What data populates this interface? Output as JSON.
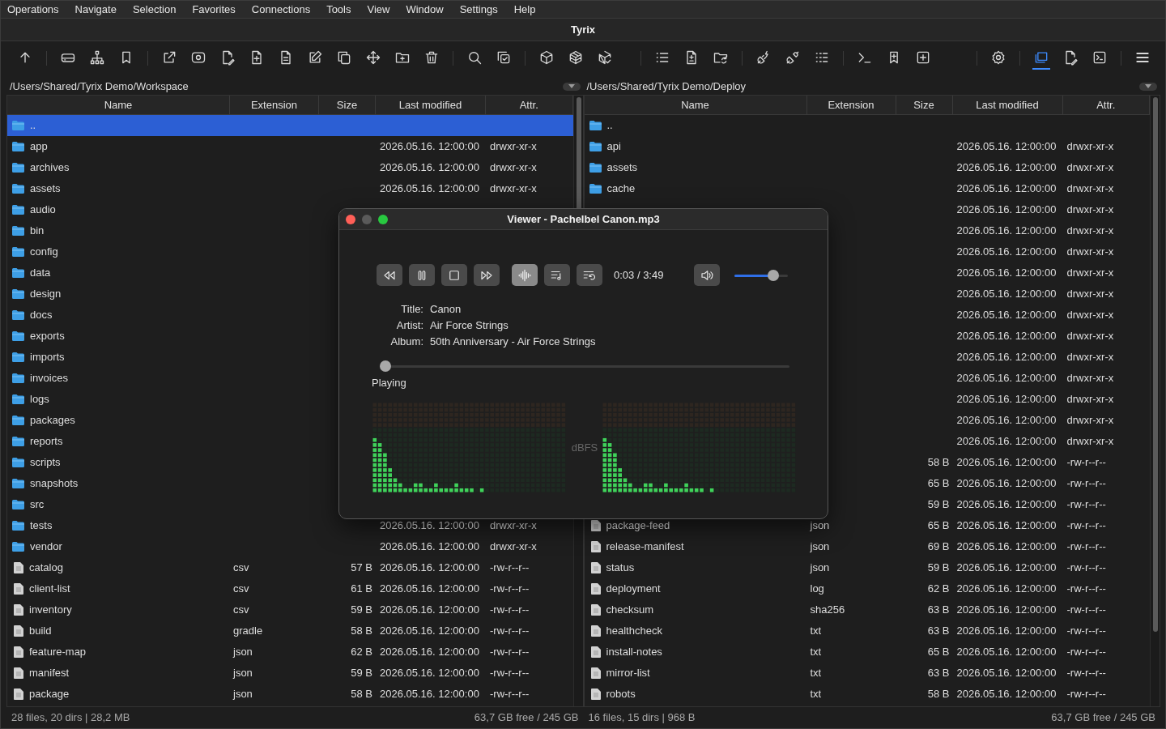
{
  "menu": [
    "Operations",
    "Navigate",
    "Selection",
    "Favorites",
    "Connections",
    "Tools",
    "View",
    "Window",
    "Settings",
    "Help"
  ],
  "window": {
    "title": "Tyrix"
  },
  "toolbar": {
    "groups": [
      [
        {
          "kind": "up",
          "selected": false
        }
      ],
      [
        {
          "kind": "drive",
          "selected": false
        },
        {
          "kind": "tree",
          "selected": false
        },
        {
          "kind": "bookmark",
          "selected": false
        }
      ],
      [
        {
          "kind": "external",
          "selected": false
        },
        {
          "kind": "view",
          "selected": false
        },
        {
          "kind": "edit-file",
          "selected": false
        },
        {
          "kind": "new-file",
          "selected": false
        },
        {
          "kind": "compare-file",
          "selected": false
        },
        {
          "kind": "edit",
          "selected": false
        },
        {
          "kind": "copy",
          "selected": false
        },
        {
          "kind": "move",
          "selected": false
        },
        {
          "kind": "new-folder",
          "selected": false
        },
        {
          "kind": "delete",
          "selected": false
        }
      ],
      [
        {
          "kind": "search",
          "selected": false
        },
        {
          "kind": "select",
          "selected": false
        }
      ],
      [
        {
          "kind": "package",
          "selected": false
        },
        {
          "kind": "packages",
          "selected": false
        },
        {
          "kind": "package-check",
          "selected": false
        }
      ],
      [
        {
          "kind": "list",
          "selected": false
        },
        {
          "kind": "file-diff",
          "selected": false
        },
        {
          "kind": "folder-sync",
          "selected": false
        }
      ],
      [
        {
          "kind": "connect",
          "selected": false
        },
        {
          "kind": "disconnect",
          "selected": false
        },
        {
          "kind": "list-dots",
          "selected": false
        }
      ],
      [
        {
          "kind": "terminal",
          "selected": false
        },
        {
          "kind": "bookmark-add",
          "selected": false
        },
        {
          "kind": "add",
          "selected": false
        }
      ],
      [
        {
          "kind": "settings",
          "selected": false
        }
      ],
      [
        {
          "kind": "panels",
          "selected": true
        },
        {
          "kind": "file-edit",
          "selected": false
        },
        {
          "kind": "console",
          "selected": false
        }
      ],
      [
        {
          "kind": "menu",
          "selected": false
        }
      ]
    ]
  },
  "panels": [
    {
      "path": "/Users/Shared/Tyrix Demo/Workspace",
      "columns": [
        "Name",
        "Extension",
        "Size",
        "Last modified",
        "Attr."
      ],
      "rows": [
        {
          "kind": "up",
          "name": "..",
          "selected": true
        },
        {
          "kind": "folder",
          "name": "app",
          "date": "2026.05.16. 12:00:00",
          "attr": "drwxr-xr-x",
          "selected": false
        },
        {
          "kind": "folder",
          "name": "archives",
          "date": "2026.05.16. 12:00:00",
          "attr": "drwxr-xr-x",
          "selected": false
        },
        {
          "kind": "folder",
          "name": "assets",
          "date": "2026.05.16. 12:00:00",
          "attr": "drwxr-xr-x",
          "selected": false
        },
        {
          "kind": "folder",
          "name": "audio",
          "selected": false
        },
        {
          "kind": "folder",
          "name": "bin",
          "selected": false
        },
        {
          "kind": "folder",
          "name": "config",
          "selected": false
        },
        {
          "kind": "folder",
          "name": "data",
          "selected": false
        },
        {
          "kind": "folder",
          "name": "design",
          "selected": false
        },
        {
          "kind": "folder",
          "name": "docs",
          "selected": false
        },
        {
          "kind": "folder",
          "name": "exports",
          "selected": false
        },
        {
          "kind": "folder",
          "name": "imports",
          "selected": false
        },
        {
          "kind": "folder",
          "name": "invoices",
          "selected": false
        },
        {
          "kind": "folder",
          "name": "logs",
          "selected": false
        },
        {
          "kind": "folder",
          "name": "packages",
          "selected": false
        },
        {
          "kind": "folder",
          "name": "reports",
          "selected": false
        },
        {
          "kind": "folder",
          "name": "scripts",
          "selected": false
        },
        {
          "kind": "folder",
          "name": "snapshots",
          "selected": false
        },
        {
          "kind": "folder",
          "name": "src",
          "selected": false
        },
        {
          "kind": "folder",
          "name": "tests",
          "date": "2026.05.16. 12:00:00",
          "attr": "drwxr-xr-x",
          "selected": false
        },
        {
          "kind": "folder",
          "name": "vendor",
          "date": "2026.05.16. 12:00:00",
          "attr": "drwxr-xr-x",
          "selected": false
        },
        {
          "kind": "file",
          "name": "catalog",
          "ext": "csv",
          "size": "57 B",
          "date": "2026.05.16. 12:00:00",
          "attr": "-rw-r--r--",
          "selected": false
        },
        {
          "kind": "file",
          "name": "client-list",
          "ext": "csv",
          "size": "61 B",
          "date": "2026.05.16. 12:00:00",
          "attr": "-rw-r--r--",
          "selected": false
        },
        {
          "kind": "file",
          "name": "inventory",
          "ext": "csv",
          "size": "59 B",
          "date": "2026.05.16. 12:00:00",
          "attr": "-rw-r--r--",
          "selected": false
        },
        {
          "kind": "file",
          "name": "build",
          "ext": "gradle",
          "size": "58 B",
          "date": "2026.05.16. 12:00:00",
          "attr": "-rw-r--r--",
          "selected": false
        },
        {
          "kind": "file",
          "name": "feature-map",
          "ext": "json",
          "size": "62 B",
          "date": "2026.05.16. 12:00:00",
          "attr": "-rw-r--r--",
          "selected": false
        },
        {
          "kind": "file",
          "name": "manifest",
          "ext": "json",
          "size": "59 B",
          "date": "2026.05.16. 12:00:00",
          "attr": "-rw-r--r--",
          "selected": false
        },
        {
          "kind": "file",
          "name": "package",
          "ext": "json",
          "size": "58 B",
          "date": "2026.05.16. 12:00:00",
          "attr": "-rw-r--r--",
          "selected": false
        }
      ],
      "status": {
        "summary": "28 files, 20 dirs | 28,2 MB",
        "free": "63,7 GB free / 245 GB"
      }
    },
    {
      "path": "/Users/Shared/Tyrix Demo/Deploy",
      "columns": [
        "Name",
        "Extension",
        "Size",
        "Last modified",
        "Attr."
      ],
      "rows": [
        {
          "kind": "up",
          "name": "..",
          "selected": false
        },
        {
          "kind": "folder",
          "name": "api",
          "date": "2026.05.16. 12:00:00",
          "attr": "drwxr-xr-x",
          "selected": false
        },
        {
          "kind": "folder",
          "name": "assets",
          "date": "2026.05.16. 12:00:00",
          "attr": "drwxr-xr-x",
          "selected": false
        },
        {
          "kind": "folder",
          "name": "cache",
          "date": "2026.05.16. 12:00:00",
          "attr": "drwxr-xr-x",
          "selected": false
        },
        {
          "date": "2026.05.16. 12:00:00",
          "attr": "drwxr-xr-x",
          "selected": false
        },
        {
          "date": "2026.05.16. 12:00:00",
          "attr": "drwxr-xr-x",
          "selected": false
        },
        {
          "date": "2026.05.16. 12:00:00",
          "attr": "drwxr-xr-x",
          "selected": false
        },
        {
          "date": "2026.05.16. 12:00:00",
          "attr": "drwxr-xr-x",
          "selected": false
        },
        {
          "date": "2026.05.16. 12:00:00",
          "attr": "drwxr-xr-x",
          "selected": false
        },
        {
          "date": "2026.05.16. 12:00:00",
          "attr": "drwxr-xr-x",
          "selected": false
        },
        {
          "date": "2026.05.16. 12:00:00",
          "attr": "drwxr-xr-x",
          "selected": false
        },
        {
          "date": "2026.05.16. 12:00:00",
          "attr": "drwxr-xr-x",
          "selected": false
        },
        {
          "date": "2026.05.16. 12:00:00",
          "attr": "drwxr-xr-x",
          "selected": false
        },
        {
          "date": "2026.05.16. 12:00:00",
          "attr": "drwxr-xr-x",
          "selected": false
        },
        {
          "date": "2026.05.16. 12:00:00",
          "attr": "drwxr-xr-x",
          "selected": false
        },
        {
          "date": "2026.05.16. 12:00:00",
          "attr": "drwxr-xr-x",
          "selected": false
        },
        {
          "size": "58 B",
          "date": "2026.05.16. 12:00:00",
          "attr": "-rw-r--r--",
          "selected": false
        },
        {
          "size": "65 B",
          "date": "2026.05.16. 12:00:00",
          "attr": "-rw-r--r--",
          "selected": false
        },
        {
          "size": "59 B",
          "date": "2026.05.16. 12:00:00",
          "attr": "-rw-r--r--",
          "selected": false
        },
        {
          "kind": "file",
          "name": "package-feed",
          "ext": "json",
          "size": "65 B",
          "date": "2026.05.16. 12:00:00",
          "attr": "-rw-r--r--",
          "selected": false
        },
        {
          "kind": "file",
          "name": "release-manifest",
          "ext": "json",
          "size": "69 B",
          "date": "2026.05.16. 12:00:00",
          "attr": "-rw-r--r--",
          "selected": false
        },
        {
          "kind": "file",
          "name": "status",
          "ext": "json",
          "size": "59 B",
          "date": "2026.05.16. 12:00:00",
          "attr": "-rw-r--r--",
          "selected": false
        },
        {
          "kind": "file",
          "name": "deployment",
          "ext": "log",
          "size": "62 B",
          "date": "2026.05.16. 12:00:00",
          "attr": "-rw-r--r--",
          "selected": false
        },
        {
          "kind": "file",
          "name": "checksum",
          "ext": "sha256",
          "size": "63 B",
          "date": "2026.05.16. 12:00:00",
          "attr": "-rw-r--r--",
          "selected": false
        },
        {
          "kind": "file",
          "name": "healthcheck",
          "ext": "txt",
          "size": "63 B",
          "date": "2026.05.16. 12:00:00",
          "attr": "-rw-r--r--",
          "selected": false
        },
        {
          "kind": "file",
          "name": "install-notes",
          "ext": "txt",
          "size": "65 B",
          "date": "2026.05.16. 12:00:00",
          "attr": "-rw-r--r--",
          "selected": false
        },
        {
          "kind": "file",
          "name": "mirror-list",
          "ext": "txt",
          "size": "63 B",
          "date": "2026.05.16. 12:00:00",
          "attr": "-rw-r--r--",
          "selected": false
        },
        {
          "kind": "file",
          "name": "robots",
          "ext": "txt",
          "size": "58 B",
          "date": "2026.05.16. 12:00:00",
          "attr": "-rw-r--r--",
          "selected": false
        }
      ],
      "status": {
        "summary": "16 files, 15 dirs | 968 B",
        "free": "63,7 GB free / 245 GB"
      }
    }
  ],
  "viewer": {
    "title": "Viewer - Pachelbel Canon.mp3",
    "buttons": [
      {
        "kind": "rewind",
        "active": false
      },
      {
        "kind": "pause",
        "active": false
      },
      {
        "kind": "stop",
        "active": false
      },
      {
        "kind": "forward",
        "active": false
      },
      {
        "kind": "waveform",
        "active": true
      },
      {
        "kind": "playlist",
        "active": false
      },
      {
        "kind": "repeat",
        "active": false
      }
    ],
    "time": "0:03 / 3:49",
    "volume": {
      "level": 0.78
    },
    "metadata": [
      {
        "label": "Title:",
        "value": "Canon"
      },
      {
        "label": "Artist:",
        "value": "Air Force Strings"
      },
      {
        "label": "Album:",
        "value": "50th Anniversary - Air Force Strings"
      }
    ],
    "progress": {
      "level": 0
    },
    "status": "Playing",
    "meter_label": "dBFS"
  }
}
